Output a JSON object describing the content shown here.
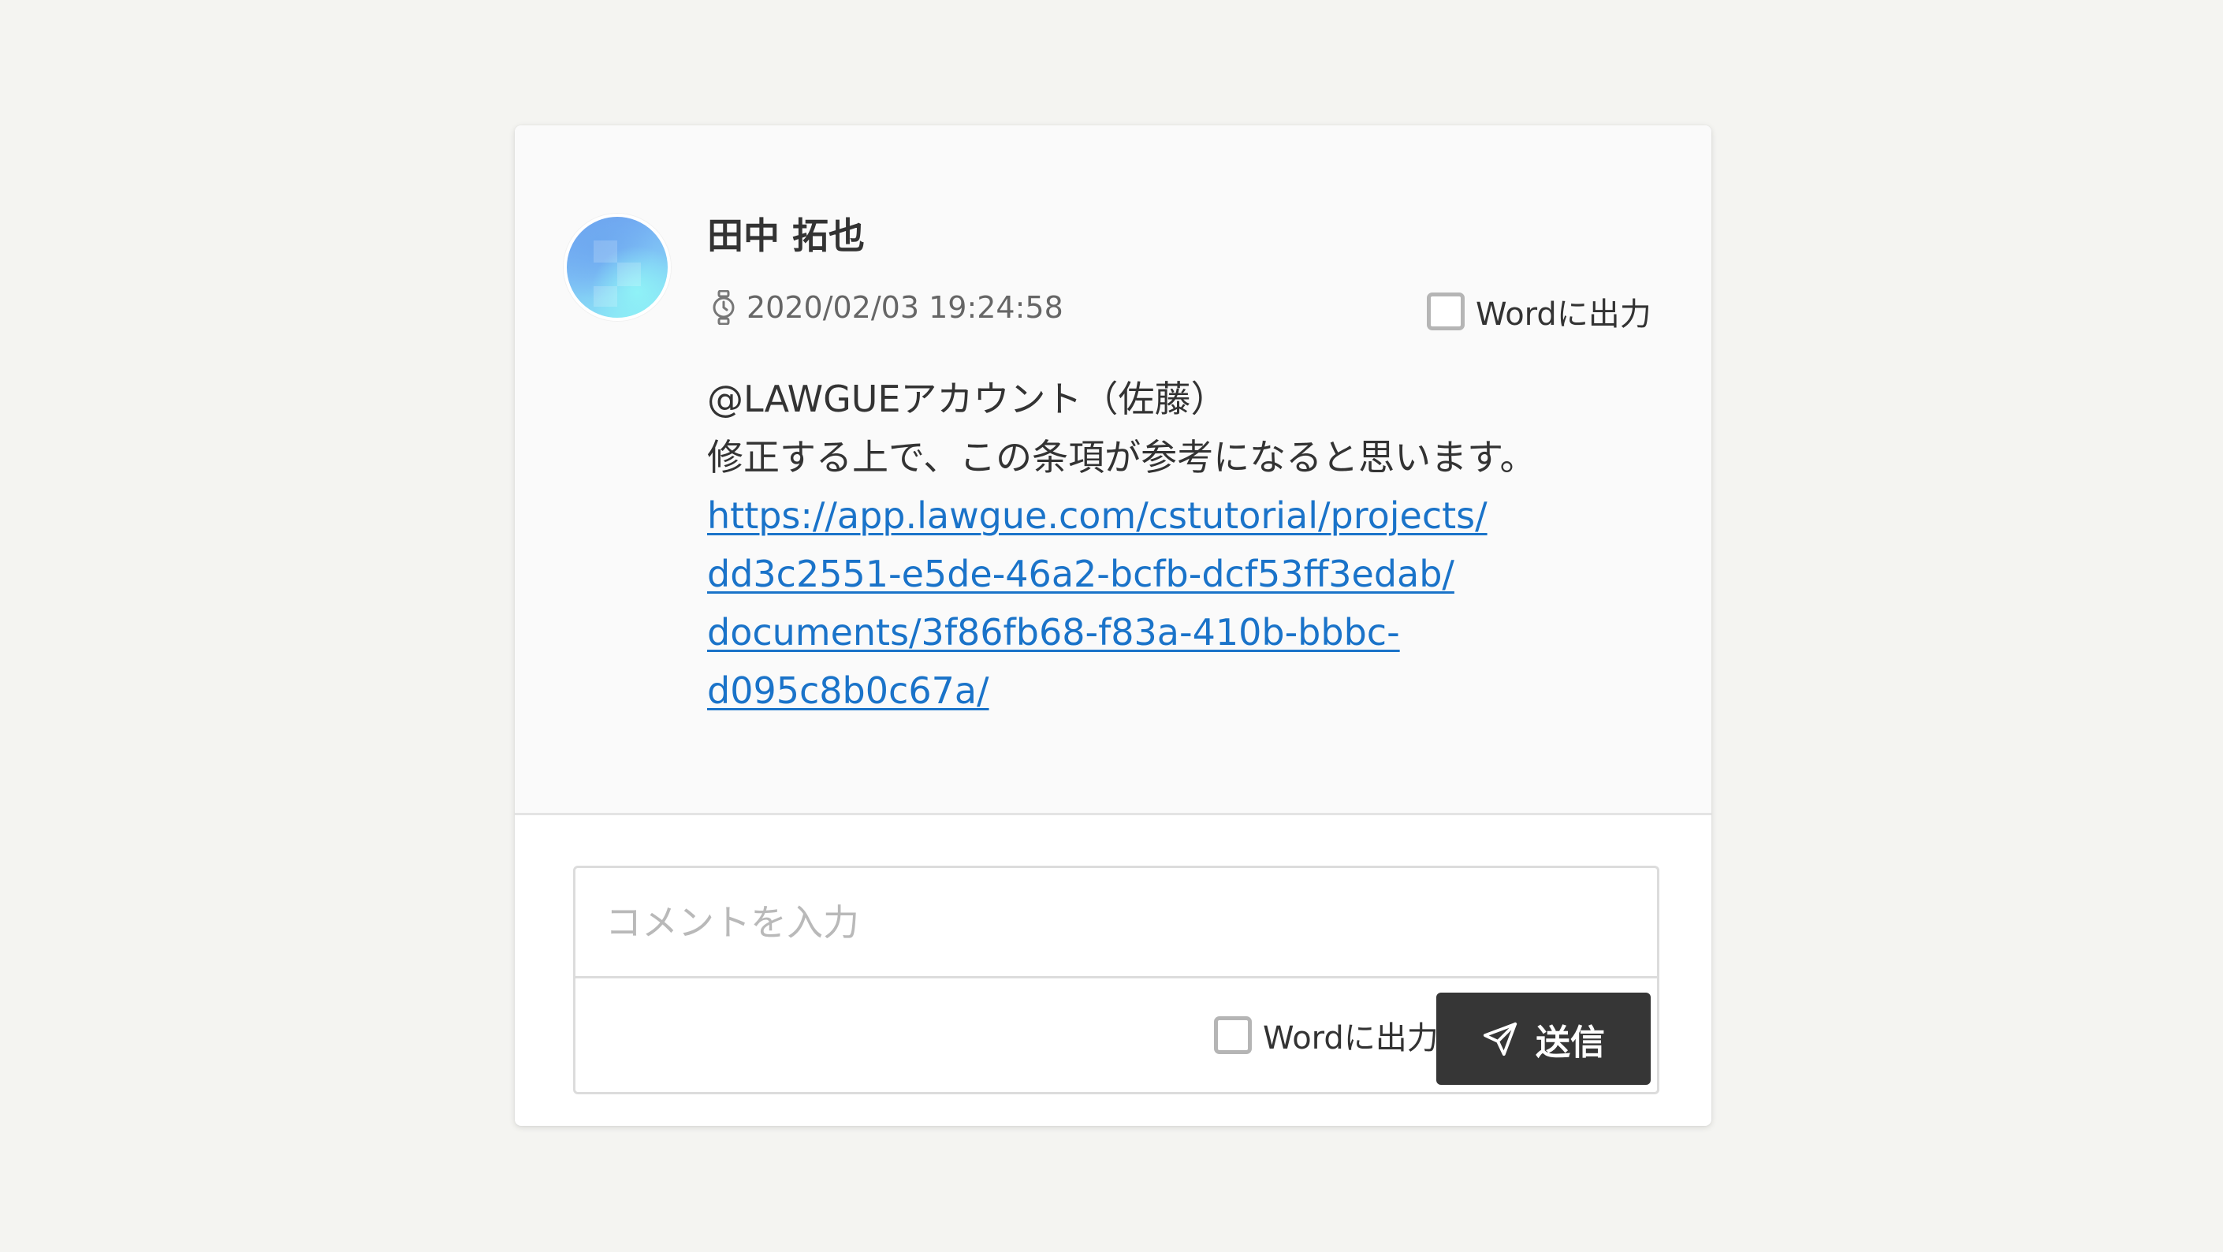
{
  "comment": {
    "author": "田中 拓也",
    "timestamp": "2020/02/03 19:24:58",
    "word_export_label": "Wordに出力",
    "body_lines": [
      "@LAWGUEアカウント（佐藤）",
      "修正する上で、この条項が参考になると思います。"
    ],
    "link_lines": [
      "https://app.lawgue.com/cstutorial/projects/",
      "dd3c2551-e5de-46a2-bcfb-dcf53ff3edab/",
      "documents/3f86fb68-f83a-410b-bbbc-",
      "d095c8b0c67a/"
    ]
  },
  "composer": {
    "placeholder": "コメントを入力",
    "word_export_label": "Wordに出力",
    "send_label": "送信"
  },
  "icons": {
    "timestamp": "watch-icon",
    "send": "paper-plane-icon"
  },
  "colors": {
    "background": "#f4f4f1",
    "link": "#1a73c9",
    "send_button": "#363636"
  }
}
